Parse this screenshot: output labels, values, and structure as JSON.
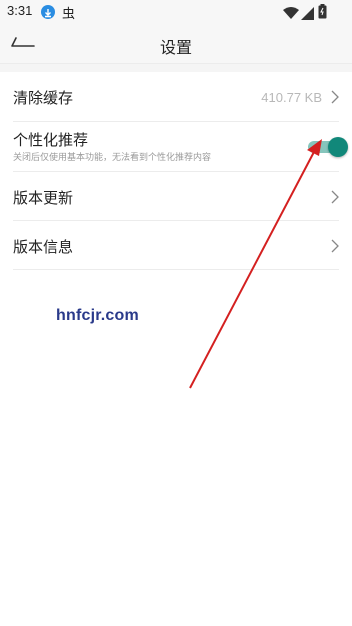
{
  "status_bar": {
    "time": "3:31",
    "app_icon": "虫",
    "icons": [
      "download-icon",
      "wifi-icon",
      "signal-icon",
      "battery-icon"
    ]
  },
  "nav": {
    "back_icon": "back-arrow-icon",
    "title": "设置"
  },
  "settings": {
    "clear_cache": {
      "label": "清除缓存",
      "value": "410.77 KB"
    },
    "personalized": {
      "label": "个性化推荐",
      "description": "关闭后仅使用基本功能，无法看到个性化推荐内容",
      "enabled": true
    },
    "version_update": {
      "label": "版本更新"
    },
    "version_info": {
      "label": "版本信息"
    }
  },
  "watermark": {
    "text": "hnfcjr.com"
  },
  "colors": {
    "accent": "#11887a",
    "toggle_track": "#86c5bc",
    "annotation_arrow": "#d42020",
    "watermark": "#2a3a8a"
  }
}
